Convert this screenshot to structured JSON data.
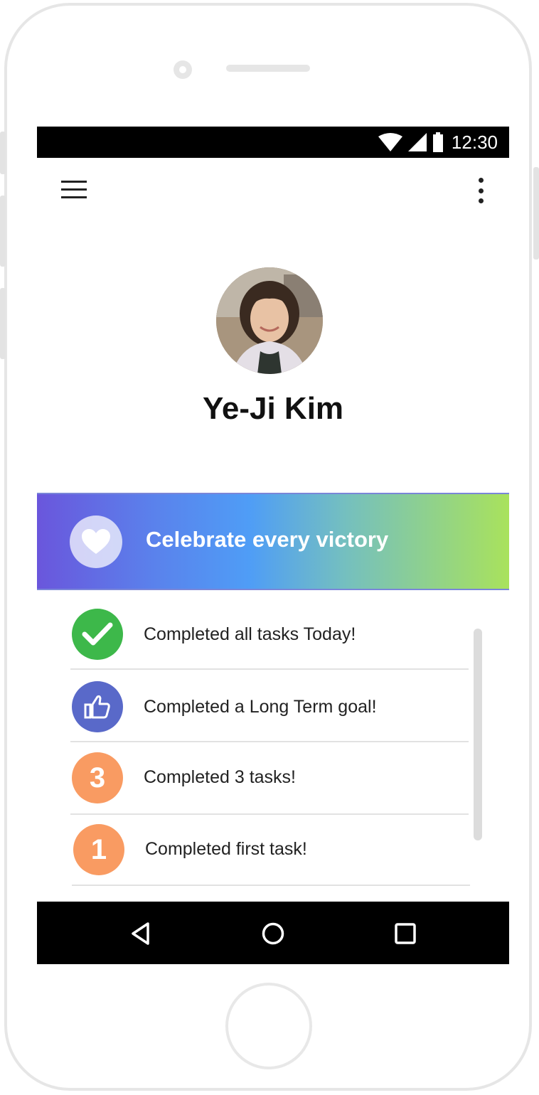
{
  "status_bar": {
    "time": "12:30"
  },
  "profile": {
    "name": "Ye-Ji Kim"
  },
  "banner": {
    "text": "Celebrate every victory"
  },
  "achievements": [
    {
      "icon": "check-icon",
      "icon_color": "#3db84a",
      "badge": "",
      "text": "Completed all tasks Today!"
    },
    {
      "icon": "thumbs-up-icon",
      "icon_color": "#5969c9",
      "badge": "",
      "text": "Completed a Long Term goal!"
    },
    {
      "icon": "number-badge",
      "icon_color": "#f99b62",
      "badge": "3",
      "text": "Completed 3 tasks!"
    },
    {
      "icon": "number-badge",
      "icon_color": "#f99b62",
      "badge": "1",
      "text": "Completed first task!"
    }
  ],
  "colors": {
    "banner_gradient": [
      "#6a56dc",
      "#4f9df6",
      "#a9e25c"
    ],
    "status_bar": "#000000",
    "nav_bar": "#000000"
  }
}
